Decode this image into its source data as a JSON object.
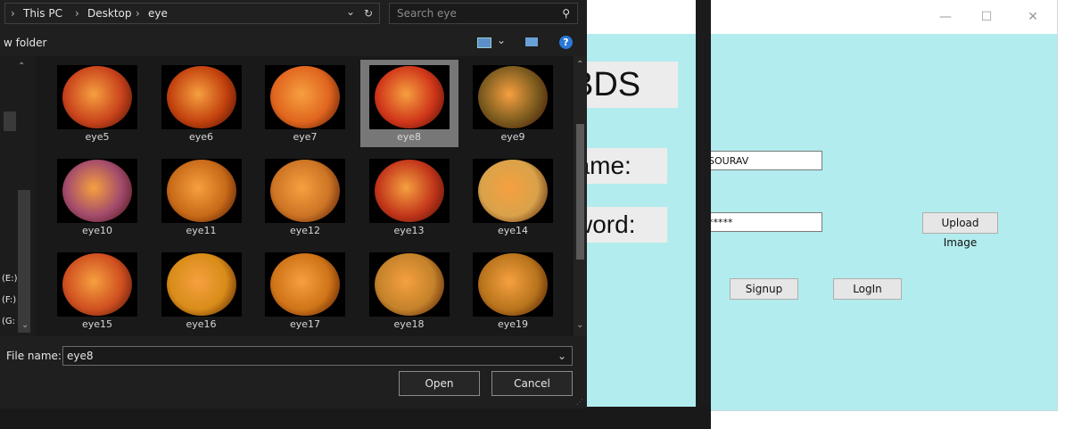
{
  "dialog": {
    "breadcrumb": [
      "This PC",
      "Desktop",
      "eye"
    ],
    "search_placeholder": "Search eye",
    "new_folder_label": "w folder",
    "nav_drives": [
      "(E:)",
      "(F:)",
      "(G:"
    ],
    "files": [
      {
        "name": "eye5",
        "hue": "#c9431c"
      },
      {
        "name": "eye6",
        "hue": "#c2410e"
      },
      {
        "name": "eye7",
        "hue": "#e0651e"
      },
      {
        "name": "eye8",
        "hue": "#d0361a"
      },
      {
        "name": "eye9",
        "hue": "#7a5a1e"
      },
      {
        "name": "eye10",
        "hue": "#a24a6c"
      },
      {
        "name": "eye11",
        "hue": "#c86a18"
      },
      {
        "name": "eye12",
        "hue": "#cc7424"
      },
      {
        "name": "eye13",
        "hue": "#c2361a"
      },
      {
        "name": "eye14",
        "hue": "#d9a24a"
      },
      {
        "name": "eye15",
        "hue": "#d05020"
      },
      {
        "name": "eye16",
        "hue": "#d88c18"
      },
      {
        "name": "eye17",
        "hue": "#cf7418"
      },
      {
        "name": "eye18",
        "hue": "#c4822a"
      },
      {
        "name": "eye19",
        "hue": "#b8741c"
      }
    ],
    "selected_file": "eye8",
    "filename_label": "File name:",
    "filename_value": "eye8",
    "open_label": "Open",
    "cancel_label": "Cancel"
  },
  "app": {
    "title_label": "BDS",
    "username_label": "name:",
    "password_label": "sword:",
    "username_value": "SOURAV",
    "password_value": "*****",
    "upload_label": "Upload Image",
    "signup_label": "Signup",
    "login_label": "LogIn",
    "background_color": "#b2ecee"
  },
  "icons": {
    "breadcrumb_sep": "›",
    "dropdown": "⌄",
    "refresh": "↻",
    "search": "⚲",
    "minimize": "—",
    "maximize": "☐",
    "close": "✕",
    "help": "?"
  }
}
